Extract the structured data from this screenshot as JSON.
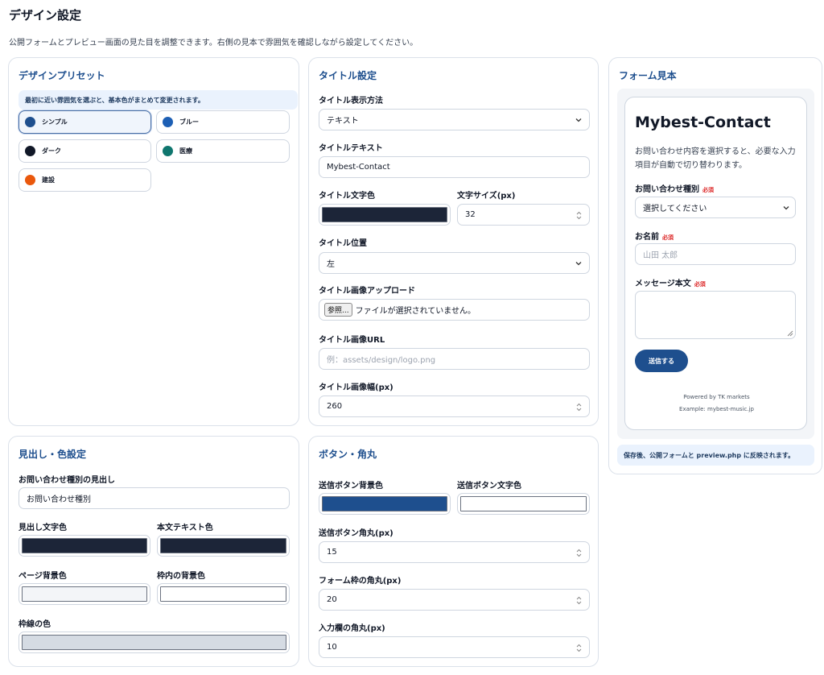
{
  "page": {
    "title": "デザイン設定",
    "description": "公開フォームとプレビュー画面の見た目を調整できます。右側の見本で雰囲気を確認しながら設定してください。"
  },
  "presets": {
    "title": "デザインプリセット",
    "note": "最初に近い雰囲気を選ぶと、基本色がまとめて変更されます。",
    "items": [
      {
        "label": "シンプル",
        "color": "#1e4f8e",
        "selected": true
      },
      {
        "label": "ブルー",
        "color": "#1d5fb4"
      },
      {
        "label": "ダーク",
        "color": "#111827"
      },
      {
        "label": "医療",
        "color": "#0f766e"
      },
      {
        "label": "建設",
        "color": "#ea580c"
      }
    ]
  },
  "title_settings": {
    "title": "タイトル設定",
    "display_method_label": "タイトル表示方法",
    "display_method_value": "テキスト",
    "title_text_label": "タイトルテキスト",
    "title_text_value": "Mybest-Contact",
    "title_color_label": "タイトル文字色",
    "title_color": "#1c2538",
    "font_size_label": "文字サイズ(px)",
    "font_size_value": "32",
    "position_label": "タイトル位置",
    "position_value": "左",
    "image_upload_label": "タイトル画像アップロード",
    "file_button": "参照...",
    "file_status": "ファイルが選択されていません。",
    "image_url_label": "タイトル画像URL",
    "image_url_placeholder": "例：assets/design/logo.png",
    "image_width_label": "タイトル画像幅(px)",
    "image_width_value": "260"
  },
  "heading_colors": {
    "title": "見出し・色設定",
    "inquiry_heading_label": "お問い合わせ種別の見出し",
    "inquiry_heading_value": "お問い合わせ種別",
    "heading_color_label": "見出し文字色",
    "heading_color": "#1c2538",
    "body_color_label": "本文テキスト色",
    "body_color": "#1c2538",
    "page_bg_label": "ページ背景色",
    "page_bg_color": "#f3f5f8",
    "inner_bg_label": "枠内の背景色",
    "inner_bg_color": "#ffffff",
    "border_color_label": "枠線の色",
    "border_color": "#d5dbe3"
  },
  "button_radius": {
    "title": "ボタン・角丸",
    "submit_bg_label": "送信ボタン背景色",
    "submit_bg_color": "#1e4f8e",
    "submit_text_label": "送信ボタン文字色",
    "submit_text_color": "#ffffff",
    "submit_radius_label": "送信ボタン角丸(px)",
    "submit_radius_value": "15",
    "form_radius_label": "フォーム枠の角丸(px)",
    "form_radius_value": "20",
    "input_radius_label": "入力欄の角丸(px)",
    "input_radius_value": "10"
  },
  "preview": {
    "title": "フォーム見本",
    "form_title": "Mybest-Contact",
    "form_description": "お問い合わせ内容を選択すると、必要な入力項目が自動で切り替わります。",
    "inquiry_label": "お問い合わせ種別",
    "required": "必須",
    "inquiry_placeholder": "選択してください",
    "name_label": "お名前",
    "name_placeholder": "山田 太郎",
    "message_label": "メッセージ本文",
    "submit_label": "送信する",
    "powered_by": "Powered by TK markets",
    "example": "Example: mybest-music.jp",
    "save_note": "保存後、公開フォームと preview.php に反映されます。"
  }
}
